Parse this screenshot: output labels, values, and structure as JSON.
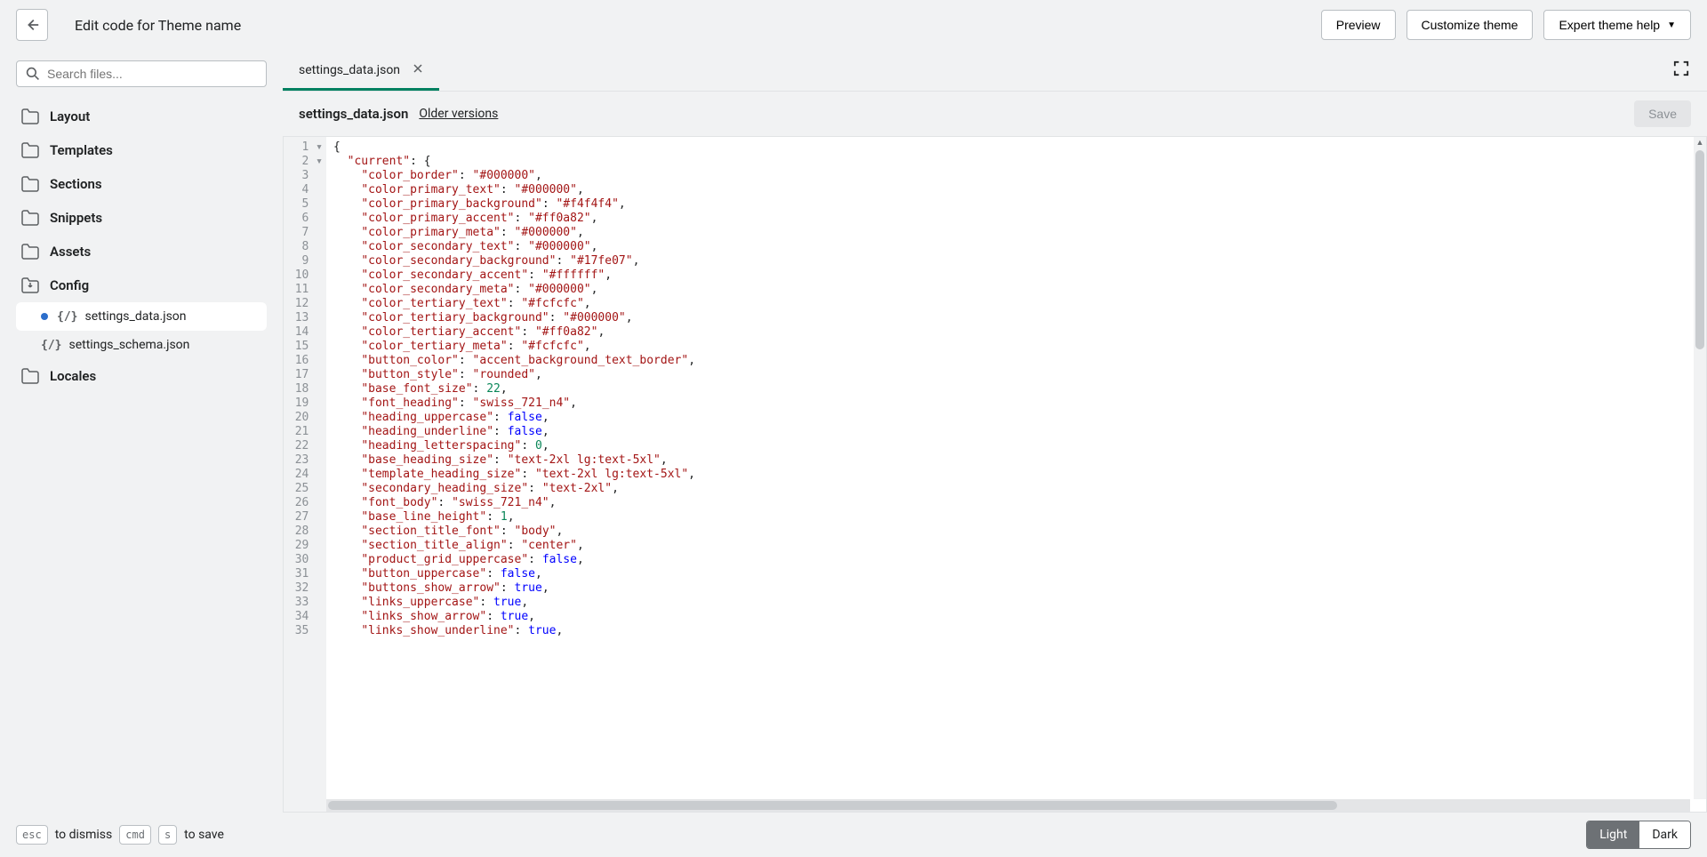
{
  "header": {
    "title": "Edit code for Theme name",
    "preview": "Preview",
    "customize": "Customize theme",
    "help": "Expert theme help"
  },
  "sidebar": {
    "search_placeholder": "Search files...",
    "folders": {
      "layout": "Layout",
      "templates": "Templates",
      "sections": "Sections",
      "snippets": "Snippets",
      "assets": "Assets",
      "config": "Config",
      "locales": "Locales"
    },
    "files": {
      "settings_data": "settings_data.json",
      "settings_schema": "settings_schema.json"
    }
  },
  "tabs": {
    "active": "settings_data.json"
  },
  "file_header": {
    "name": "settings_data.json",
    "older": "Older versions",
    "save": "Save"
  },
  "footer": {
    "esc": "esc",
    "dismiss": "to dismiss",
    "cmd": "cmd",
    "s": "s",
    "save": "to save",
    "light": "Light",
    "dark": "Dark"
  },
  "code_lines": [
    [
      [
        "p",
        "{"
      ]
    ],
    [
      [
        "p",
        "  "
      ],
      [
        "k",
        "\"current\""
      ],
      [
        "p",
        ": {"
      ]
    ],
    [
      [
        "p",
        "    "
      ],
      [
        "k",
        "\"color_border\""
      ],
      [
        "p",
        ": "
      ],
      [
        "s",
        "\"#000000\""
      ],
      [
        "p",
        ","
      ]
    ],
    [
      [
        "p",
        "    "
      ],
      [
        "k",
        "\"color_primary_text\""
      ],
      [
        "p",
        ": "
      ],
      [
        "s",
        "\"#000000\""
      ],
      [
        "p",
        ","
      ]
    ],
    [
      [
        "p",
        "    "
      ],
      [
        "k",
        "\"color_primary_background\""
      ],
      [
        "p",
        ": "
      ],
      [
        "s",
        "\"#f4f4f4\""
      ],
      [
        "p",
        ","
      ]
    ],
    [
      [
        "p",
        "    "
      ],
      [
        "k",
        "\"color_primary_accent\""
      ],
      [
        "p",
        ": "
      ],
      [
        "s",
        "\"#ff0a82\""
      ],
      [
        "p",
        ","
      ]
    ],
    [
      [
        "p",
        "    "
      ],
      [
        "k",
        "\"color_primary_meta\""
      ],
      [
        "p",
        ": "
      ],
      [
        "s",
        "\"#000000\""
      ],
      [
        "p",
        ","
      ]
    ],
    [
      [
        "p",
        "    "
      ],
      [
        "k",
        "\"color_secondary_text\""
      ],
      [
        "p",
        ": "
      ],
      [
        "s",
        "\"#000000\""
      ],
      [
        "p",
        ","
      ]
    ],
    [
      [
        "p",
        "    "
      ],
      [
        "k",
        "\"color_secondary_background\""
      ],
      [
        "p",
        ": "
      ],
      [
        "s",
        "\"#17fe07\""
      ],
      [
        "p",
        ","
      ]
    ],
    [
      [
        "p",
        "    "
      ],
      [
        "k",
        "\"color_secondary_accent\""
      ],
      [
        "p",
        ": "
      ],
      [
        "s",
        "\"#ffffff\""
      ],
      [
        "p",
        ","
      ]
    ],
    [
      [
        "p",
        "    "
      ],
      [
        "k",
        "\"color_secondary_meta\""
      ],
      [
        "p",
        ": "
      ],
      [
        "s",
        "\"#000000\""
      ],
      [
        "p",
        ","
      ]
    ],
    [
      [
        "p",
        "    "
      ],
      [
        "k",
        "\"color_tertiary_text\""
      ],
      [
        "p",
        ": "
      ],
      [
        "s",
        "\"#fcfcfc\""
      ],
      [
        "p",
        ","
      ]
    ],
    [
      [
        "p",
        "    "
      ],
      [
        "k",
        "\"color_tertiary_background\""
      ],
      [
        "p",
        ": "
      ],
      [
        "s",
        "\"#000000\""
      ],
      [
        "p",
        ","
      ]
    ],
    [
      [
        "p",
        "    "
      ],
      [
        "k",
        "\"color_tertiary_accent\""
      ],
      [
        "p",
        ": "
      ],
      [
        "s",
        "\"#ff0a82\""
      ],
      [
        "p",
        ","
      ]
    ],
    [
      [
        "p",
        "    "
      ],
      [
        "k",
        "\"color_tertiary_meta\""
      ],
      [
        "p",
        ": "
      ],
      [
        "s",
        "\"#fcfcfc\""
      ],
      [
        "p",
        ","
      ]
    ],
    [
      [
        "p",
        "    "
      ],
      [
        "k",
        "\"button_color\""
      ],
      [
        "p",
        ": "
      ],
      [
        "s",
        "\"accent_background_text_border\""
      ],
      [
        "p",
        ","
      ]
    ],
    [
      [
        "p",
        "    "
      ],
      [
        "k",
        "\"button_style\""
      ],
      [
        "p",
        ": "
      ],
      [
        "s",
        "\"rounded\""
      ],
      [
        "p",
        ","
      ]
    ],
    [
      [
        "p",
        "    "
      ],
      [
        "k",
        "\"base_font_size\""
      ],
      [
        "p",
        ": "
      ],
      [
        "n",
        "22"
      ],
      [
        "p",
        ","
      ]
    ],
    [
      [
        "p",
        "    "
      ],
      [
        "k",
        "\"font_heading\""
      ],
      [
        "p",
        ": "
      ],
      [
        "s",
        "\"swiss_721_n4\""
      ],
      [
        "p",
        ","
      ]
    ],
    [
      [
        "p",
        "    "
      ],
      [
        "k",
        "\"heading_uppercase\""
      ],
      [
        "p",
        ": "
      ],
      [
        "b",
        "false"
      ],
      [
        "p",
        ","
      ]
    ],
    [
      [
        "p",
        "    "
      ],
      [
        "k",
        "\"heading_underline\""
      ],
      [
        "p",
        ": "
      ],
      [
        "b",
        "false"
      ],
      [
        "p",
        ","
      ]
    ],
    [
      [
        "p",
        "    "
      ],
      [
        "k",
        "\"heading_letterspacing\""
      ],
      [
        "p",
        ": "
      ],
      [
        "n",
        "0"
      ],
      [
        "p",
        ","
      ]
    ],
    [
      [
        "p",
        "    "
      ],
      [
        "k",
        "\"base_heading_size\""
      ],
      [
        "p",
        ": "
      ],
      [
        "s",
        "\"text-2xl lg:text-5xl\""
      ],
      [
        "p",
        ","
      ]
    ],
    [
      [
        "p",
        "    "
      ],
      [
        "k",
        "\"template_heading_size\""
      ],
      [
        "p",
        ": "
      ],
      [
        "s",
        "\"text-2xl lg:text-5xl\""
      ],
      [
        "p",
        ","
      ]
    ],
    [
      [
        "p",
        "    "
      ],
      [
        "k",
        "\"secondary_heading_size\""
      ],
      [
        "p",
        ": "
      ],
      [
        "s",
        "\"text-2xl\""
      ],
      [
        "p",
        ","
      ]
    ],
    [
      [
        "p",
        "    "
      ],
      [
        "k",
        "\"font_body\""
      ],
      [
        "p",
        ": "
      ],
      [
        "s",
        "\"swiss_721_n4\""
      ],
      [
        "p",
        ","
      ]
    ],
    [
      [
        "p",
        "    "
      ],
      [
        "k",
        "\"base_line_height\""
      ],
      [
        "p",
        ": "
      ],
      [
        "n",
        "1"
      ],
      [
        "p",
        ","
      ]
    ],
    [
      [
        "p",
        "    "
      ],
      [
        "k",
        "\"section_title_font\""
      ],
      [
        "p",
        ": "
      ],
      [
        "s",
        "\"body\""
      ],
      [
        "p",
        ","
      ]
    ],
    [
      [
        "p",
        "    "
      ],
      [
        "k",
        "\"section_title_align\""
      ],
      [
        "p",
        ": "
      ],
      [
        "s",
        "\"center\""
      ],
      [
        "p",
        ","
      ]
    ],
    [
      [
        "p",
        "    "
      ],
      [
        "k",
        "\"product_grid_uppercase\""
      ],
      [
        "p",
        ": "
      ],
      [
        "b",
        "false"
      ],
      [
        "p",
        ","
      ]
    ],
    [
      [
        "p",
        "    "
      ],
      [
        "k",
        "\"button_uppercase\""
      ],
      [
        "p",
        ": "
      ],
      [
        "b",
        "false"
      ],
      [
        "p",
        ","
      ]
    ],
    [
      [
        "p",
        "    "
      ],
      [
        "k",
        "\"buttons_show_arrow\""
      ],
      [
        "p",
        ": "
      ],
      [
        "b",
        "true"
      ],
      [
        "p",
        ","
      ]
    ],
    [
      [
        "p",
        "    "
      ],
      [
        "k",
        "\"links_uppercase\""
      ],
      [
        "p",
        ": "
      ],
      [
        "b",
        "true"
      ],
      [
        "p",
        ","
      ]
    ],
    [
      [
        "p",
        "    "
      ],
      [
        "k",
        "\"links_show_arrow\""
      ],
      [
        "p",
        ": "
      ],
      [
        "b",
        "true"
      ],
      [
        "p",
        ","
      ]
    ],
    [
      [
        "p",
        "    "
      ],
      [
        "k",
        "\"links_show_underline\""
      ],
      [
        "p",
        ": "
      ],
      [
        "b",
        "true"
      ],
      [
        "p",
        ","
      ]
    ]
  ]
}
